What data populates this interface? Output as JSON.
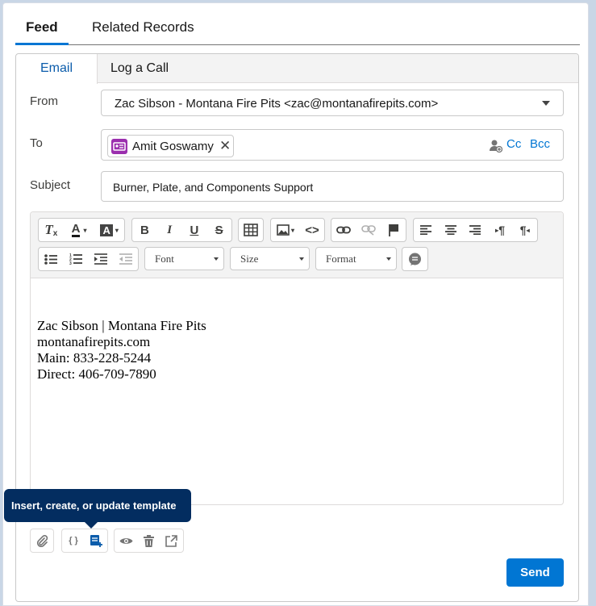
{
  "top_tabs": [
    {
      "label": "Feed",
      "active": true
    },
    {
      "label": "Related Records",
      "active": false
    }
  ],
  "sub_tabs": [
    {
      "label": "Email",
      "active": true
    },
    {
      "label": "Log a Call",
      "active": false
    }
  ],
  "from": {
    "label": "From",
    "value": "Zac Sibson - Montana Fire Pits <zac@montanafirepits.com>"
  },
  "to": {
    "label": "To",
    "recipient": "Amit Goswamy",
    "cc_label": "Cc",
    "bcc_label": "Bcc"
  },
  "subject": {
    "label": "Subject",
    "value": "Burner, Plate, and Components Support"
  },
  "toolbar": {
    "font_label": "Font",
    "size_label": "Size",
    "format_label": "Format"
  },
  "body": {
    "lines": [
      "Zac Sibson | Montana Fire Pits",
      "montanafirepits.com",
      "Main: 833-228-5244",
      "Direct: 406-709-7890"
    ]
  },
  "tooltip": {
    "text": "Insert, create, or update template"
  },
  "send_label": "Send",
  "colors": {
    "accent": "#0176d3",
    "tooltip_bg": "#032d60",
    "avatar": "#9b2fae"
  }
}
